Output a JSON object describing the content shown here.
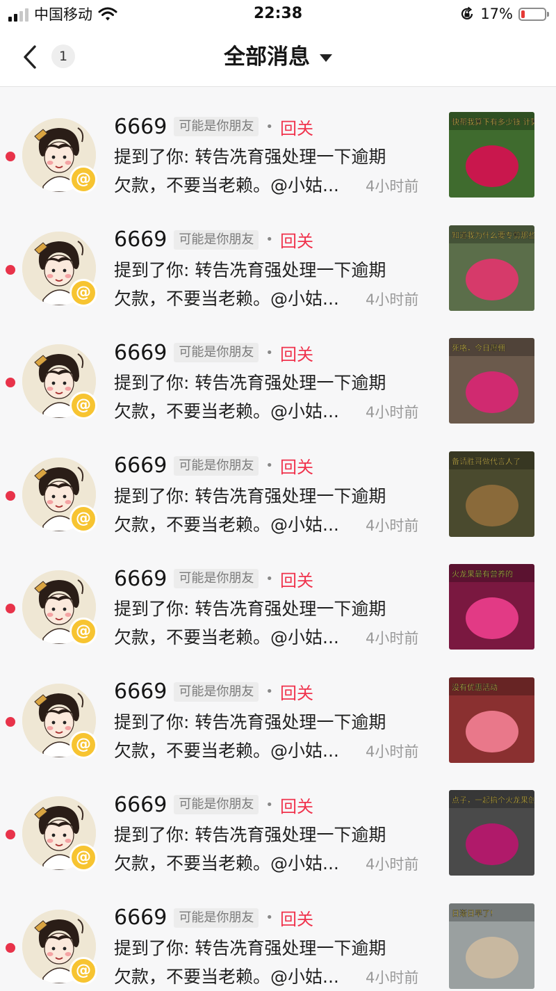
{
  "status_bar": {
    "carrier": "中国移动",
    "time": "22:38",
    "battery_text": "17%",
    "battery_level": 0.17,
    "signal_bars": 2,
    "icons": [
      "signal-icon",
      "wifi-icon",
      "rotation-lock-icon",
      "battery-icon"
    ]
  },
  "header": {
    "back_icon": "chevron-left-icon",
    "unread_count": "1",
    "title": "全部消息",
    "dropdown_icon": "caret-down-icon"
  },
  "colors": {
    "accent_red": "#f0334d",
    "unread_dot": "#e8334a",
    "at_badge": "#f7c431"
  },
  "messages": [
    {
      "username": "6669",
      "tag": "可能是你朋友",
      "action": "回关",
      "line1": "提到了你: 转告冼育强处理一下逾期",
      "line2": "欠款，不要当老赖。@小姑...",
      "time": "4小时前",
      "thumb_caption": "快帮我算下有多少钱 计算器按冒烟了!"
    },
    {
      "username": "6669",
      "tag": "可能是你朋友",
      "action": "回关",
      "line1": "提到了你: 转告冼育强处理一下逾期",
      "line2": "欠款，不要当老赖。@小姑...",
      "time": "4小时前",
      "thumb_caption": "知道我为什么要专剪那些开裂的吗"
    },
    {
      "username": "6669",
      "tag": "可能是你朋友",
      "action": "回关",
      "line1": "提到了你: 转告冼育强处理一下逾期",
      "line2": "欠款，不要当老赖。@小姑...",
      "time": "4小时前",
      "thumb_caption": "死咯，今日爆棚"
    },
    {
      "username": "6669",
      "tag": "可能是你朋友",
      "action": "回关",
      "line1": "提到了你: 转告冼育强处理一下逾期",
      "line2": "欠款，不要当老赖。@小姑...",
      "time": "4小时前",
      "thumb_caption": "备请胜哥做代言人了"
    },
    {
      "username": "6669",
      "tag": "可能是你朋友",
      "action": "回关",
      "line1": "提到了你: 转告冼育强处理一下逾期",
      "line2": "欠款，不要当老赖。@小姑...",
      "time": "4小时前",
      "thumb_caption": "火龙果最有营养的"
    },
    {
      "username": "6669",
      "tag": "可能是你朋友",
      "action": "回关",
      "line1": "提到了你: 转告冼育强处理一下逾期",
      "line2": "欠款，不要当老赖。@小姑...",
      "time": "4小时前",
      "thumb_caption": "没有优惠活动"
    },
    {
      "username": "6669",
      "tag": "可能是你朋友",
      "action": "回关",
      "line1": "提到了你: 转告冼育强处理一下逾期",
      "line2": "欠款，不要当老赖。@小姑...",
      "time": "4小时前",
      "thumb_caption": "点子，一起搞个火龙果创意小食"
    },
    {
      "username": "6669",
      "tag": "可能是你朋友",
      "action": "回关",
      "line1": "提到了你: 转告冼育强处理一下逾期",
      "line2": "欠款，不要当老赖。@小姑...",
      "time": "4小时前",
      "thumb_caption": "日渐日早了!"
    }
  ]
}
